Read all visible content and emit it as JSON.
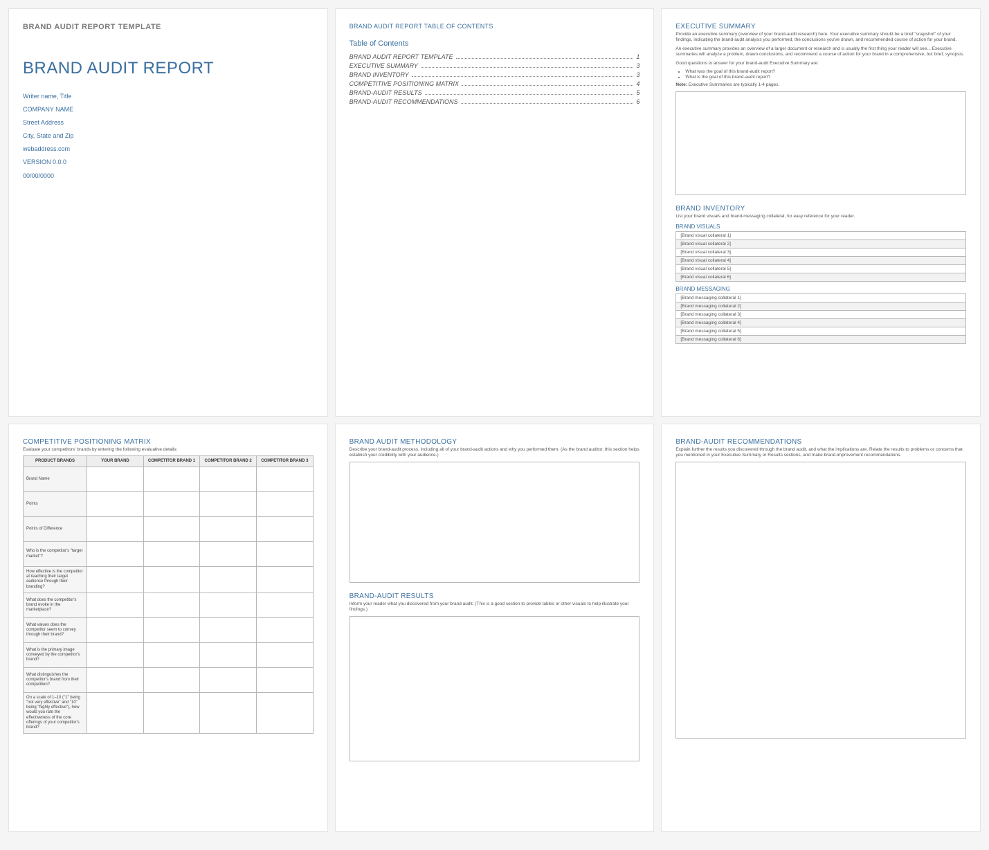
{
  "page1": {
    "templateLabel": "BRAND AUDIT REPORT TEMPLATE",
    "reportTitle": "BRAND AUDIT REPORT",
    "writer": "Writer name, Title",
    "company": "COMPANY NAME",
    "street": "Street Address",
    "cityzip": "City, State and Zip",
    "web": "webaddress.com",
    "version": "VERSION 0.0.0",
    "date": "00/00/0000"
  },
  "page2": {
    "header": "BRAND AUDIT REPORT TABLE OF CONTENTS",
    "tocTitle": "Table of Contents",
    "toc": [
      {
        "label": "BRAND AUDIT REPORT TEMPLATE",
        "pg": "1"
      },
      {
        "label": "EXECUTIVE SUMMARY",
        "pg": "3"
      },
      {
        "label": "BRAND INVENTORY",
        "pg": "3"
      },
      {
        "label": "COMPETITIVE POSITIONING MATRIX",
        "pg": "4"
      },
      {
        "label": "BRAND-AUDIT RESULTS",
        "pg": "5"
      },
      {
        "label": "BRAND-AUDIT RECOMMENDATIONS",
        "pg": "6"
      }
    ]
  },
  "page3": {
    "exec": {
      "title": "EXECUTIVE SUMMARY",
      "p1": "Provide an executive summary (overview of your brand-audit research) here. Your executive summary should be a brief \"snapshot\" of your findings, indicating the brand-audit analysis you performed, the conclusions you've drawn, and recommended course of action for your brand.",
      "p2": "An executive summary provides an overview of a larger document or research and is usually the first thing your reader will see... Executive summaries will analyze a problem, drawn conclusions, and recommend a course of action for your brand in a comprehensive, but brief, synopsis.",
      "p3": "Good questions to answer for your brand-audit Executive Summary are:",
      "b1": "What was the goal of this brand-audit report?",
      "b2": "What is the goal of this brand-audit report?",
      "noteLabel": "Note:",
      "noteText": " Executive Summaries are typically 1-4 pages."
    },
    "inv": {
      "title": "BRAND INVENTORY",
      "desc": "List your brand visuals and brand-messaging collateral, for easy reference for your reader.",
      "visTitle": "BRAND VISUALS",
      "visuals": [
        "[Brand visual collateral 1]",
        "[Brand visual collateral 2]",
        "[Brand visual collateral 3]",
        "[Brand visual collateral 4]",
        "[Brand visual collateral 5]",
        "[Brand visual collateral 6]"
      ],
      "msgTitle": "BRAND MESSAGING",
      "messaging": [
        "[Brand messaging collateral 1]",
        "[Brand messaging collateral 2]",
        "[Brand messaging collateral 3]",
        "[Brand messaging collateral 4]",
        "[Brand messaging collateral 5]",
        "[Brand messaging collateral 6]"
      ]
    }
  },
  "page4": {
    "title": "COMPETITIVE POSITIONING MATRIX",
    "desc": "Evaluate your competitors' brands by entering the following evaluative details:",
    "headers": [
      "PRODUCT BRANDS",
      "YOUR BRAND",
      "COMPETITOR BRAND 1",
      "COMPETITOR BRAND 2",
      "COMPETITOR BRAND 3"
    ],
    "rows": [
      "Brand Name",
      "Points",
      "Points of Difference",
      "Who is the competitor's \"target market\"?",
      "How effective is the competitor at reaching their target audience through their branding?",
      "What does the competitor's brand evoke in the marketplace?",
      "What values does the competitor seem to convey through their brand?",
      "What is the primary image conveyed by the competitor's brand?",
      "What distinguishes the competitor's brand from their competition?",
      "On a scale of 1–10 (\"1\" being \"not very effective\" and \"10\" being \"highly effective\"), how would you rate the effectiveness of the core offerings of your competitor's brand?"
    ]
  },
  "page5": {
    "meth": {
      "title": "BRAND AUDIT METHODOLOGY",
      "desc": "Describe your brand-audit process, including all of your brand-audit actions and why you performed them. (As the brand auditor, this section helps establish your credibility with your audience.)"
    },
    "results": {
      "title": "BRAND-AUDIT RESULTS",
      "desc": "Inform your reader what you discovered from your brand audit. (This is a good section to provide tables or other visuals to help illustrate your findings.)"
    }
  },
  "page6": {
    "title": "BRAND-AUDIT RECOMMENDATIONS",
    "desc": "Explain further the results you discovered through the brand audit, and what the implications are. Relate the results to problems or concerns that you mentioned in your Executive Summary or Results sections, and make brand-improvement recommendations."
  }
}
